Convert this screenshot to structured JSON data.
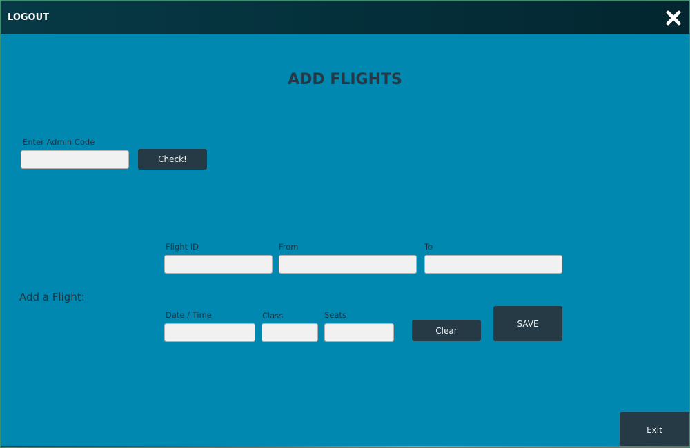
{
  "window": {
    "logout_label": "LOGOUT",
    "close_icon": "close-icon"
  },
  "page": {
    "title": "ADD FLIGHTS"
  },
  "admin": {
    "label": "Enter Admin Code",
    "value": "",
    "placeholder": "",
    "check_label": "Check!"
  },
  "flight_form": {
    "section_label": "Add a Flight:",
    "fields": {
      "flight_id": {
        "label": "Flight ID",
        "value": ""
      },
      "from": {
        "label": "From",
        "value": ""
      },
      "to": {
        "label": "To",
        "value": ""
      },
      "date_time": {
        "label": "Date / Time",
        "value": ""
      },
      "class": {
        "label": "Class",
        "value": ""
      },
      "seats": {
        "label": "Seats",
        "value": ""
      }
    },
    "clear_label": "Clear",
    "save_label": "SAVE"
  },
  "footer": {
    "exit_label": "Exit"
  },
  "colors": {
    "background": "#0088b0",
    "titlebar": "#04303b",
    "button": "#263a45",
    "field": "#f1f1f1"
  }
}
